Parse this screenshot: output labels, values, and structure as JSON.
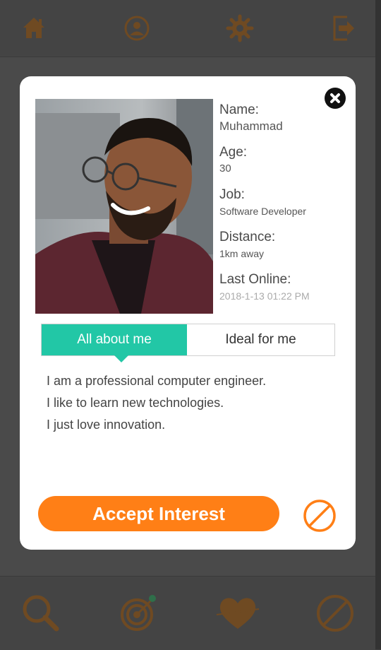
{
  "colors": {
    "accent_orange": "#ff7f16",
    "accent_teal": "#22c7a6",
    "dim_icon": "#6f4a22"
  },
  "topbar": {
    "icons": [
      "home-icon",
      "profile-icon",
      "settings-icon",
      "logout-icon"
    ]
  },
  "bottombar": {
    "icons": [
      "search-icon",
      "target-icon",
      "cupid-heart-icon",
      "block-icon"
    ]
  },
  "profile": {
    "name_label": "Name:",
    "name": "Muhammad",
    "age_label": "Age:",
    "age": "30",
    "job_label": "Job:",
    "job": "Software Developer",
    "distance_label": "Distance:",
    "distance": "1km away",
    "last_online_label": "Last Online:",
    "last_online": "2018-1-13 01:22 PM"
  },
  "tabs": {
    "about_label": "All about me",
    "ideal_label": "Ideal for me"
  },
  "about": {
    "lines": [
      "I am a professional computer engineer.",
      "I like to learn new technologies.",
      "I just love innovation."
    ]
  },
  "actions": {
    "accept_label": "Accept Interest"
  }
}
